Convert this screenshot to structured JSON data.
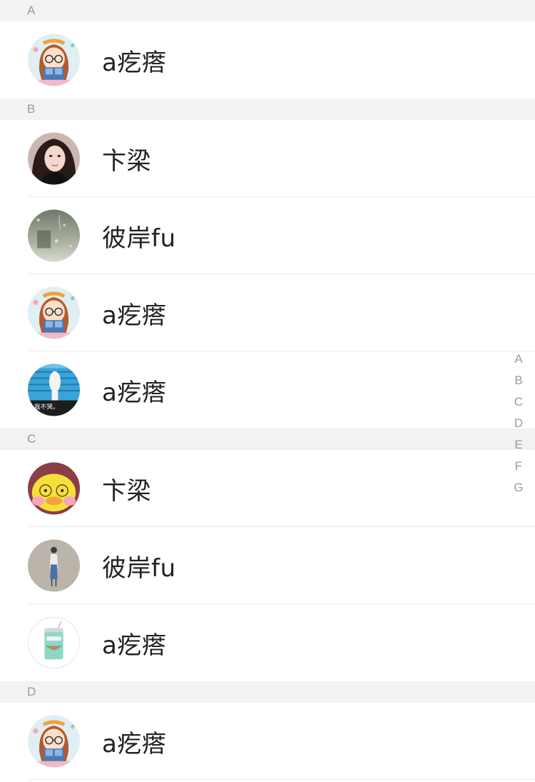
{
  "sections": [
    {
      "letter": "A",
      "contacts": [
        {
          "name": "a疙瘩",
          "avatar": "girl-reading-avatar",
          "divider": false
        }
      ]
    },
    {
      "letter": "B",
      "contacts": [
        {
          "name": "卞梁",
          "avatar": "selfie-photo-avatar",
          "divider": true
        },
        {
          "name": "彼岸fu",
          "avatar": "rainy-window-avatar",
          "divider": true
        },
        {
          "name": "a疙瘩",
          "avatar": "girl-reading-avatar",
          "divider": true
        },
        {
          "name": "a疙瘩",
          "avatar": "wall-photo-avatar",
          "divider": false
        }
      ]
    },
    {
      "letter": "C",
      "contacts": [
        {
          "name": "卞梁",
          "avatar": "yellow-duck-avatar",
          "divider": true
        },
        {
          "name": "彼岸fu",
          "avatar": "standing-figure-avatar",
          "divider": true
        },
        {
          "name": "a疙瘩",
          "avatar": "drink-can-avatar",
          "divider": false
        }
      ]
    },
    {
      "letter": "D",
      "contacts": [
        {
          "name": "a疙瘩",
          "avatar": "girl-reading-avatar",
          "divider": true
        }
      ]
    }
  ],
  "index_letters": [
    "A",
    "B",
    "C",
    "D",
    "E",
    "F",
    "G"
  ],
  "wall_photo_caption": "我不哭。",
  "colors": {
    "section_bg": "#f2f2f2",
    "section_text": "#999999",
    "name_text": "#222222",
    "index_text": "#9a9a9a",
    "divider": "#ececec"
  }
}
